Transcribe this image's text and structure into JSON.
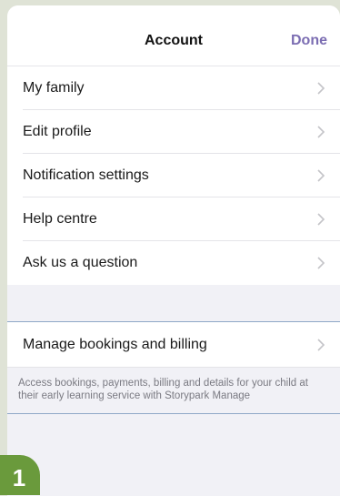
{
  "navbar": {
    "title": "Account",
    "done_label": "Done"
  },
  "menu": {
    "items": [
      {
        "label": "My family",
        "icon": "chevron-right-icon"
      },
      {
        "label": "Edit profile",
        "icon": "chevron-right-icon"
      },
      {
        "label": "Notification settings",
        "icon": "chevron-right-icon"
      },
      {
        "label": "Help centre",
        "icon": "chevron-right-icon"
      },
      {
        "label": "Ask us a question",
        "icon": "chevron-right-icon"
      }
    ]
  },
  "billing": {
    "label": "Manage bookings and billing",
    "description": "Access bookings, payments, billing and details for your child at their early learning service with Storypark Manage"
  },
  "step_badge": {
    "number": "1",
    "color": "#6a9a3c"
  },
  "colors": {
    "accent": "#7b6db2",
    "chevron": "#c4c4c8",
    "highlight_border": "#8fa8c7"
  }
}
